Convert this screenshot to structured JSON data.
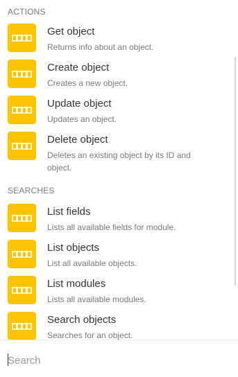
{
  "actions": {
    "header": "ACTIONS",
    "items": [
      {
        "title": "Get object",
        "desc": "Returns info about an object."
      },
      {
        "title": "Create object",
        "desc": "Creates a new object."
      },
      {
        "title": "Update object",
        "desc": "Updates an object."
      },
      {
        "title": "Delete object",
        "desc": "Deletes an existing object by its ID and object."
      }
    ]
  },
  "searches": {
    "header": "SEARCHES",
    "items": [
      {
        "title": "List fields",
        "desc": "Lists all available fields for module."
      },
      {
        "title": "List objects",
        "desc": "List all available objects."
      },
      {
        "title": "List modules",
        "desc": "Lists all available modules."
      },
      {
        "title": "Search objects",
        "desc": "Searches for an object."
      }
    ]
  },
  "app_icon": {
    "name": "zoho-logo-icon",
    "background": "#ffc400"
  },
  "search": {
    "placeholder": "Search",
    "value": ""
  }
}
